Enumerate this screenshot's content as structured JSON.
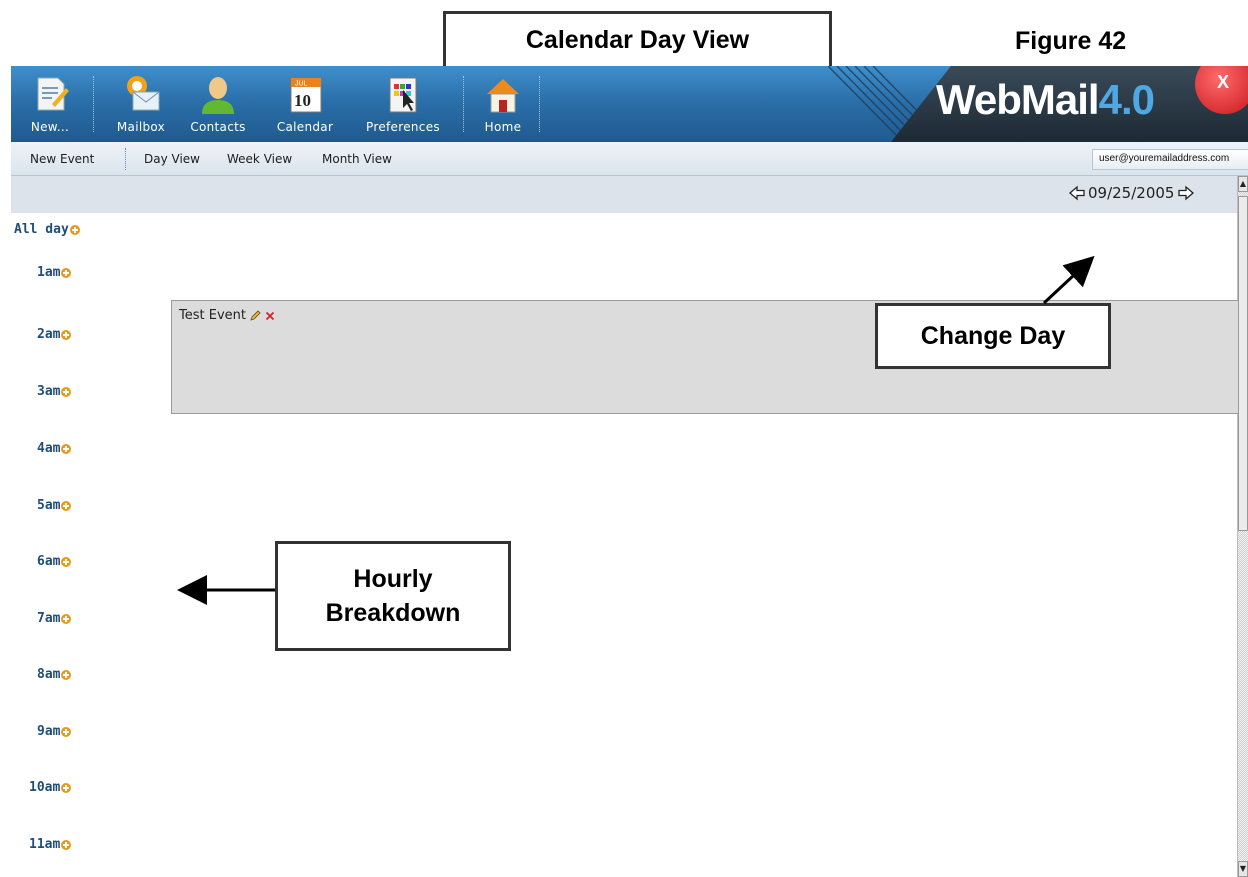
{
  "figure": {
    "title": "Calendar Day View",
    "number": "Figure 42"
  },
  "toolbar": {
    "items": [
      {
        "label": "New...",
        "icon": "new-document-icon"
      },
      {
        "label": "Mailbox",
        "icon": "mailbox-icon"
      },
      {
        "label": "Contacts",
        "icon": "contacts-icon"
      },
      {
        "label": "Calendar",
        "icon": "calendar-icon",
        "icon_month": "JUL",
        "icon_day": "10"
      },
      {
        "label": "Preferences",
        "icon": "preferences-icon"
      },
      {
        "label": "Home",
        "icon": "home-icon"
      }
    ],
    "brand": {
      "word": "WebMail",
      "version": "4.0"
    },
    "close_label": "X"
  },
  "subnav": {
    "new_event": "New Event",
    "day_view": "Day View",
    "week_view": "Week View",
    "month_view": "Month View",
    "user": "user@youremailaddress.com"
  },
  "date_nav": {
    "date": "09/25/2005",
    "prev_icon": "left-arrow-icon",
    "next_icon": "right-arrow-icon"
  },
  "hours": [
    "All day",
    "1am",
    "2am",
    "3am",
    "4am",
    "5am",
    "6am",
    "7am",
    "8am",
    "9am",
    "10am",
    "11am"
  ],
  "event": {
    "title": "Test Event",
    "edit_icon": "pencil-icon",
    "delete_icon": "delete-x-icon"
  },
  "callouts": {
    "change_day": "Change Day",
    "hourly_line1": "Hourly",
    "hourly_line2": "Breakdown"
  },
  "colors": {
    "toolbar_blue": "#2a6ea8",
    "brand_accent": "#4fa7e3",
    "hour_label": "#1f4d78",
    "plus_icon": "#e69a1c",
    "event_bg": "#dcdcdc"
  }
}
